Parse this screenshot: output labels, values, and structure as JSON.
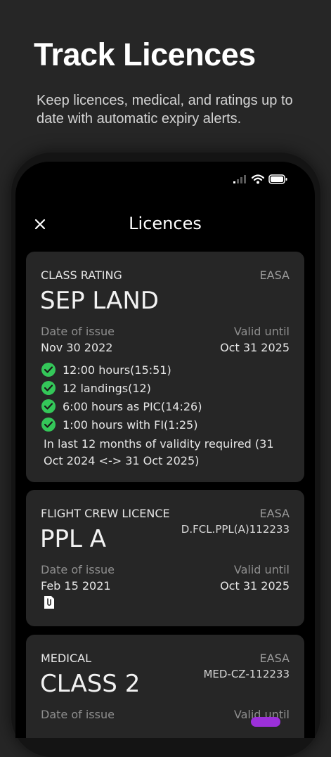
{
  "promo": {
    "title": "Track Licences",
    "subtitle": "Keep licences, medical, and ratings up to date with automatic expiry alerts."
  },
  "nav": {
    "title": "Licences",
    "close_icon": "close-icon"
  },
  "colors": {
    "check": "#34c759",
    "card_bg": "#262626",
    "screen_bg": "#000000"
  },
  "cards": [
    {
      "type": "CLASS RATING",
      "authority": "EASA",
      "name": "SEP LAND",
      "issue_label": "Date of issue",
      "issue_date": "Nov 30 2022",
      "valid_label": "Valid until",
      "valid_date": "Oct 31 2025",
      "requirements": [
        "12:00 hours(15:51)",
        "12 landings(12)",
        "6:00 hours as PIC(14:26)",
        "1:00 hours with FI(1:25)"
      ],
      "note": "In last 12 months of validity required (31 Oct 2024 <-> 31 Oct 2025)"
    },
    {
      "type": "FLIGHT CREW LICENCE",
      "authority": "EASA",
      "reference": "D.FCL.PPL(A)112233",
      "name": "PPL A",
      "issue_label": "Date of issue",
      "issue_date": "Feb 15 2021",
      "valid_label": "Valid until",
      "valid_date": "Oct 31 2025",
      "attachment_icon": "attachment-icon"
    },
    {
      "type": "MEDICAL",
      "authority": "EASA",
      "reference": "MED-CZ-112233",
      "name": "CLASS 2",
      "issue_label": "Date of issue",
      "valid_label": "Valid until"
    }
  ]
}
